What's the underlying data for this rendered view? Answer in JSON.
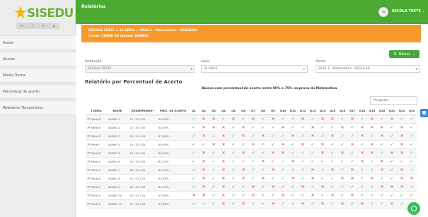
{
  "sidebar": {
    "logo_text": "SISEDU",
    "accessibility": [
      "A+",
      "A",
      "A-",
      "◐"
    ],
    "items": [
      "Home",
      "Alunos",
      "Minha Turma",
      "Percentual de acerto",
      "Relatórios Temporários"
    ]
  },
  "topbar": {
    "title": "Relatórios",
    "user": "ESCOLA TESTE"
  },
  "breadcrumb": {
    "line1": "ESCOLA TESTE  >  3ª SÉRIE  >  2024.1 - Matemática - REGULAR",
    "line2": "Credo: CREDE 06   Cidade: SOBRAL"
  },
  "download_button": "Baixar",
  "filters": {
    "instituicao": {
      "label": "Instituição",
      "value": "ESCOLA TESTE"
    },
    "serie": {
      "label": "Série",
      "value": "3ª SÉRIE"
    },
    "oferta": {
      "label": "Oferta",
      "value": "2024.1 - Matemática - REGULAR"
    }
  },
  "section_title": "Relatório por Percentual de Acerto",
  "table_caption": "Alunos com percentual de acerto entre 50% e 75% na prova de Matemática",
  "search_placeholder": "Pesquisar",
  "table": {
    "headers": [
      "TURMA",
      "NOME",
      "DESEMPENHO*",
      "PERC. DE ACERTO"
    ],
    "questions": [
      "Q1",
      "Q2",
      "Q3",
      "Q4",
      "Q5",
      "Q6",
      "Q7",
      "Q8",
      "Q9",
      "Q10",
      "Q11",
      "Q12",
      "Q13",
      "Q14",
      "Q15",
      "Q16",
      "Q17",
      "Q18",
      "Q19",
      "Q20",
      "Q21",
      "Q22",
      "Q23"
    ],
    "rows": [
      {
        "turma": "3ª Série B",
        "nome": "ALUNO 1",
        "desempenho": "13 / 10 / 26",
        "perc": "50,00%",
        "marks": "1001010101101001010101101"
      },
      {
        "turma": "3ª Série B",
        "nome": "ALUNO 2",
        "desempenho": "13 / 10 / 26",
        "perc": "50,00%",
        "marks": "1000101110110110100010110"
      },
      {
        "turma": "3ª Série B",
        "nome": "ALUNO 3",
        "desempenho": "15 / 11 / 26",
        "perc": "57,69%",
        "marks": "1010101011010101101010101"
      },
      {
        "turma": "3ª Série F",
        "nome": "ALUNO 4",
        "desempenho": "13 / 10 / 26",
        "perc": "50,00%",
        "marks": "1100110110101011010110101"
      },
      {
        "turma": "3ª Série B",
        "nome": "ALUNO 5",
        "desempenho": "13 / 10 / 26",
        "perc": "50,00%",
        "marks": "1010101100111010100100101"
      },
      {
        "turma": "3ª Série A",
        "nome": "ALUNO 6",
        "desempenho": "16 / 10 / 26",
        "perc": "61,54%",
        "marks": "1010111011011111101011101"
      },
      {
        "turma": "3ª Série A",
        "nome": "ALUNO 7",
        "desempenho": "16 / 10 / 26",
        "perc": "61,54%",
        "marks": "1010101101110101011010111"
      },
      {
        "turma": "3ª Série A",
        "nome": "ALUNO 8",
        "desempenho": "14 / 12 / 26",
        "perc": "53,85%",
        "marks": "1010101011010110010110011"
      },
      {
        "turma": "3ª Série A",
        "nome": "ALUNO 9",
        "desempenho": "16 / 10 / 26",
        "perc": "61,54%",
        "marks": "1010110101101011111000101"
      },
      {
        "turma": "3ª Série A",
        "nome": "ALUNO 10",
        "desempenho": "15 / 11 / 26",
        "perc": "57,69%",
        "marks": "0010110110110101011111101"
      },
      {
        "turma": "3ª Série A",
        "nome": "ALUNO 11",
        "desempenho": "15 / 11 / 26",
        "perc": "57,69%",
        "marks": "1110101101101010101101011"
      }
    ]
  },
  "colors": {
    "green": "#4caa33",
    "orange": "#f79a2b",
    "ok": "#3ea535",
    "wrong": "#d93a3a"
  }
}
